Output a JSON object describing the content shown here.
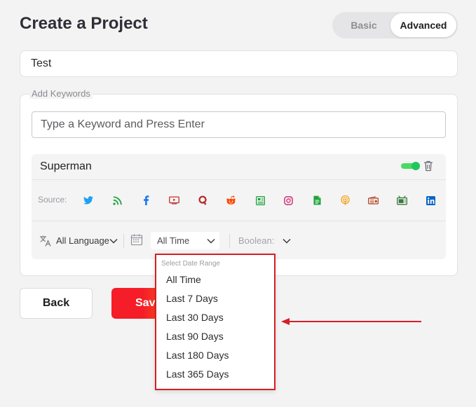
{
  "page": {
    "title": "Create a Project"
  },
  "mode": {
    "basic": "Basic",
    "advanced": "Advanced",
    "selected": "Advanced"
  },
  "project": {
    "name": "Test"
  },
  "keywords": {
    "legend": "Add Keywords",
    "input_placeholder": "Type a Keyword and Press Enter",
    "card": {
      "name": "Superman",
      "enabled": true,
      "source_label": "Source:",
      "sources": [
        {
          "icon": "twitter-icon",
          "color": "#1da1f2"
        },
        {
          "icon": "rss-icon",
          "color": "#1fa33a"
        },
        {
          "icon": "facebook-icon",
          "color": "#1877f2"
        },
        {
          "icon": "youtube-icon",
          "color": "#c4302b"
        },
        {
          "icon": "quora-icon",
          "color": "#b92b27"
        },
        {
          "icon": "reddit-icon",
          "color": "#ff4500"
        },
        {
          "icon": "news-icon",
          "color": "#1fa33a"
        },
        {
          "icon": "instagram-icon",
          "color": "#c13584"
        },
        {
          "icon": "document-icon",
          "color": "#1fa33a"
        },
        {
          "icon": "podcast-icon",
          "color": "#f5a623"
        },
        {
          "icon": "radio-icon",
          "color": "#b44b2b"
        },
        {
          "icon": "tv-icon",
          "color": "#3a7a3a"
        },
        {
          "icon": "linkedin-icon",
          "color": "#0a66c2"
        }
      ],
      "language": "All Language",
      "time": "All Time",
      "boolean": "Boolean:"
    }
  },
  "buttons": {
    "back": "Back",
    "save": "Save"
  },
  "date_range": {
    "header": "Select Date Range",
    "options": [
      "All Time",
      "Last 7 Days",
      "Last 30 Days",
      "Last 90 Days",
      "Last 180 Days",
      "Last 365 Days"
    ]
  },
  "colors": {
    "accent_red": "#f51d28",
    "toggle_green": "#22c55e",
    "highlight_border": "#d51f24"
  }
}
